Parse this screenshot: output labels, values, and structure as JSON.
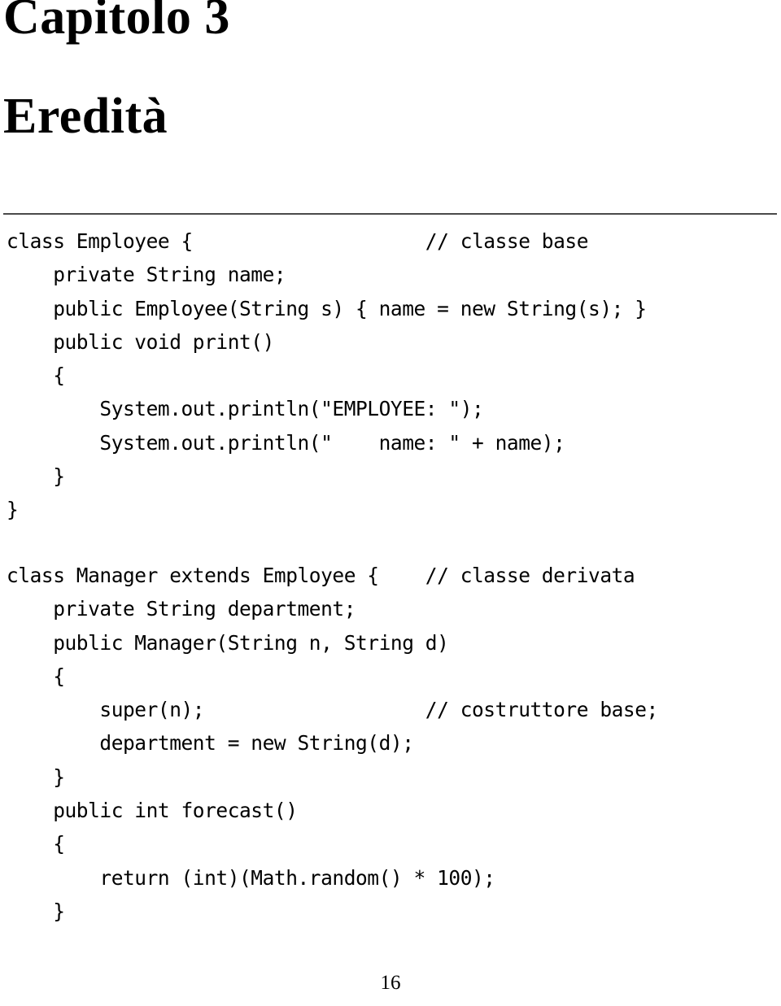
{
  "document": {
    "chapter_label": "Capitolo 3",
    "chapter_title": "Eredità",
    "page_number": "16"
  },
  "code_blocks": [
    {
      "id": "employee",
      "language": "java",
      "lines": [
        "class Employee {                    // classe base",
        "    private String name;",
        "    public Employee(String s) { name = new String(s); }",
        "    public void print()",
        "    {",
        "        System.out.println(\"EMPLOYEE: \");",
        "        System.out.println(\"    name: \" + name);",
        "    }",
        "}"
      ]
    },
    {
      "id": "manager",
      "language": "java",
      "lines": [
        "class Manager extends Employee {    // classe derivata",
        "    private String department;",
        "    public Manager(String n, String d)",
        "    {",
        "        super(n);                   // costruttore base;",
        "        department = new String(d);",
        "    }",
        "    public int forecast()",
        "    {",
        "        return (int)(Math.random() * 100);",
        "    }"
      ]
    }
  ],
  "colors": {
    "text": "#000000",
    "rule": "#4a4a4a",
    "background": "#ffffff"
  }
}
